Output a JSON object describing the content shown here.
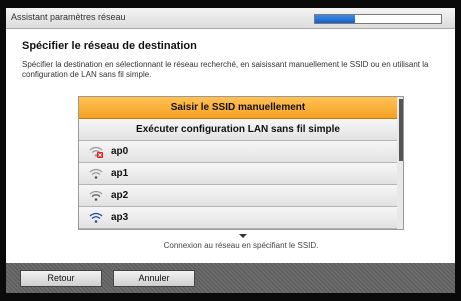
{
  "window": {
    "title": "Assistant paramètres réseau",
    "progress": 0.32
  },
  "heading": "Spécifier le réseau de destination",
  "description": "Spécifier la destination en sélectionnant le réseau recherché, en saisissant manuellement le SSID ou en utilisant la configuration de LAN sans fil simple.",
  "list": {
    "items": [
      {
        "label": "Saisir le SSID manuellement",
        "selected": true
      },
      {
        "label": "Exécuter configuration LAN sans fil simple",
        "selected": false
      },
      {
        "label": "ap0",
        "icon": "wifi-locked-icon",
        "signal": 1
      },
      {
        "label": "ap1",
        "icon": "wifi-icon",
        "signal": 1
      },
      {
        "label": "ap2",
        "icon": "wifi-icon",
        "signal": 2
      },
      {
        "label": "ap3",
        "icon": "wifi-icon",
        "signal": 3
      }
    ]
  },
  "hint": "Connexion au réseau en spécifiant le SSID.",
  "buttons": {
    "back": "Retour",
    "cancel": "Annuler"
  },
  "colors": {
    "selected": "#f5a223",
    "progress": "#1a5fc4",
    "lock_badge": "#e02020"
  }
}
